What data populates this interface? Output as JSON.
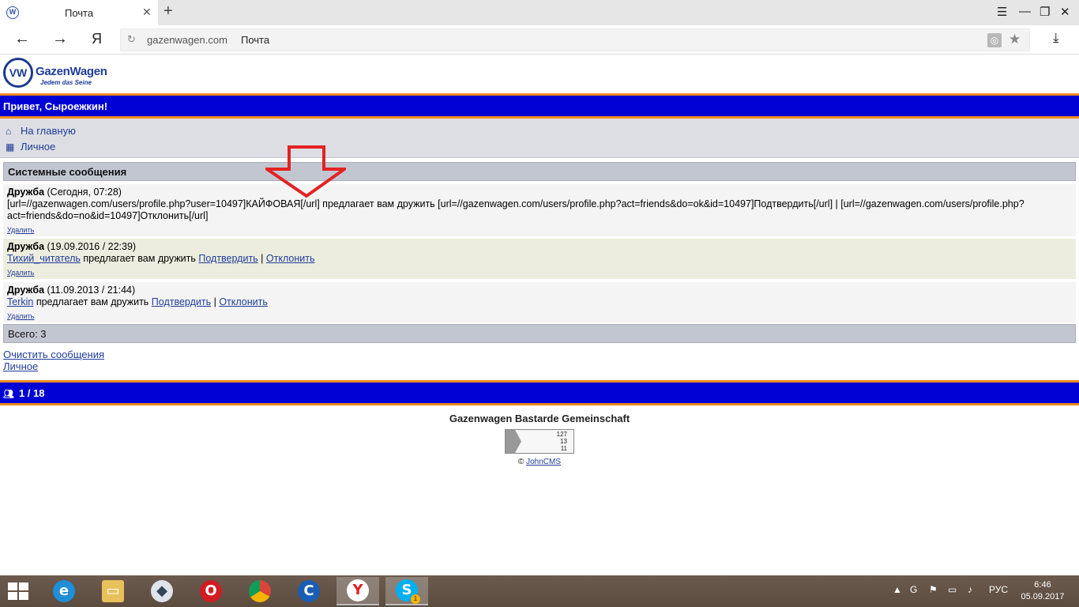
{
  "browser": {
    "tab_title": "Почта",
    "tab_close": "✕",
    "new_tab": "+",
    "url_host": "gazenwagen.com",
    "url_title": "Почта",
    "yandex_btn": "Я",
    "win_menu": "☰",
    "win_minimize": "—",
    "win_restore": "❐",
    "win_close": "✕"
  },
  "site": {
    "logo_mark": "VW",
    "logo_text": "GazenWagen",
    "logo_sub": "Jedem das Seine",
    "greeting": "Привет, Сыроежкин!",
    "menu": [
      {
        "label": "На главную",
        "icon": "home-icon"
      },
      {
        "label": "Личное",
        "icon": "grid-icon"
      }
    ],
    "section_title": "Системные сообщения",
    "messages": [
      {
        "type": "Дружба",
        "date": "(Сегодня, 07:28)",
        "body_raw": "[url=//gazenwagen.com/users/profile.php?user=10497]КАЙФОВАЯ[/url] предлагает вам дружить [url=//gazenwagen.com/users/profile.php?act=friends&do=ok&id=10497]Подтвердить[/url] | [url=//gazenwagen.com/users/profile.php?act=friends&do=no&id=10497]Отклонить[/url]",
        "delete": "Удалить"
      },
      {
        "type": "Дружба",
        "date": "(19.09.2016 / 22:39)",
        "user": "Тихий_читатель",
        "text": " предлагает вам дружить ",
        "confirm": "Подтвердить",
        "sep": " | ",
        "reject": "Отклонить",
        "delete": "Удалить"
      },
      {
        "type": "Дружба",
        "date": "(11.09.2013 / 21:44)",
        "user": "Terkin",
        "text": " предлагает вам дружить ",
        "confirm": "Подтвердить",
        "sep": " | ",
        "reject": "Отклонить",
        "delete": "Удалить"
      }
    ],
    "total": "Всего: 3",
    "clear_link": "Очистить сообщения",
    "personal_link": "Личное",
    "online": "1 / 18",
    "footer_title": "Gazenwagen Bastarde Gemeinschaft",
    "counter": [
      "127",
      "13",
      "11"
    ],
    "copyright_prefix": "© ",
    "copyright_link": "JohnCMS"
  },
  "taskbar": {
    "lang": "РУС",
    "time": "6:46",
    "date": "05.09.2017",
    "skype_badge": "1"
  },
  "colors": {
    "header_blue": "#0000d4",
    "accent_orange": "#ee8a20",
    "link": "#1f3d99",
    "arrow_red": "#e32222"
  }
}
